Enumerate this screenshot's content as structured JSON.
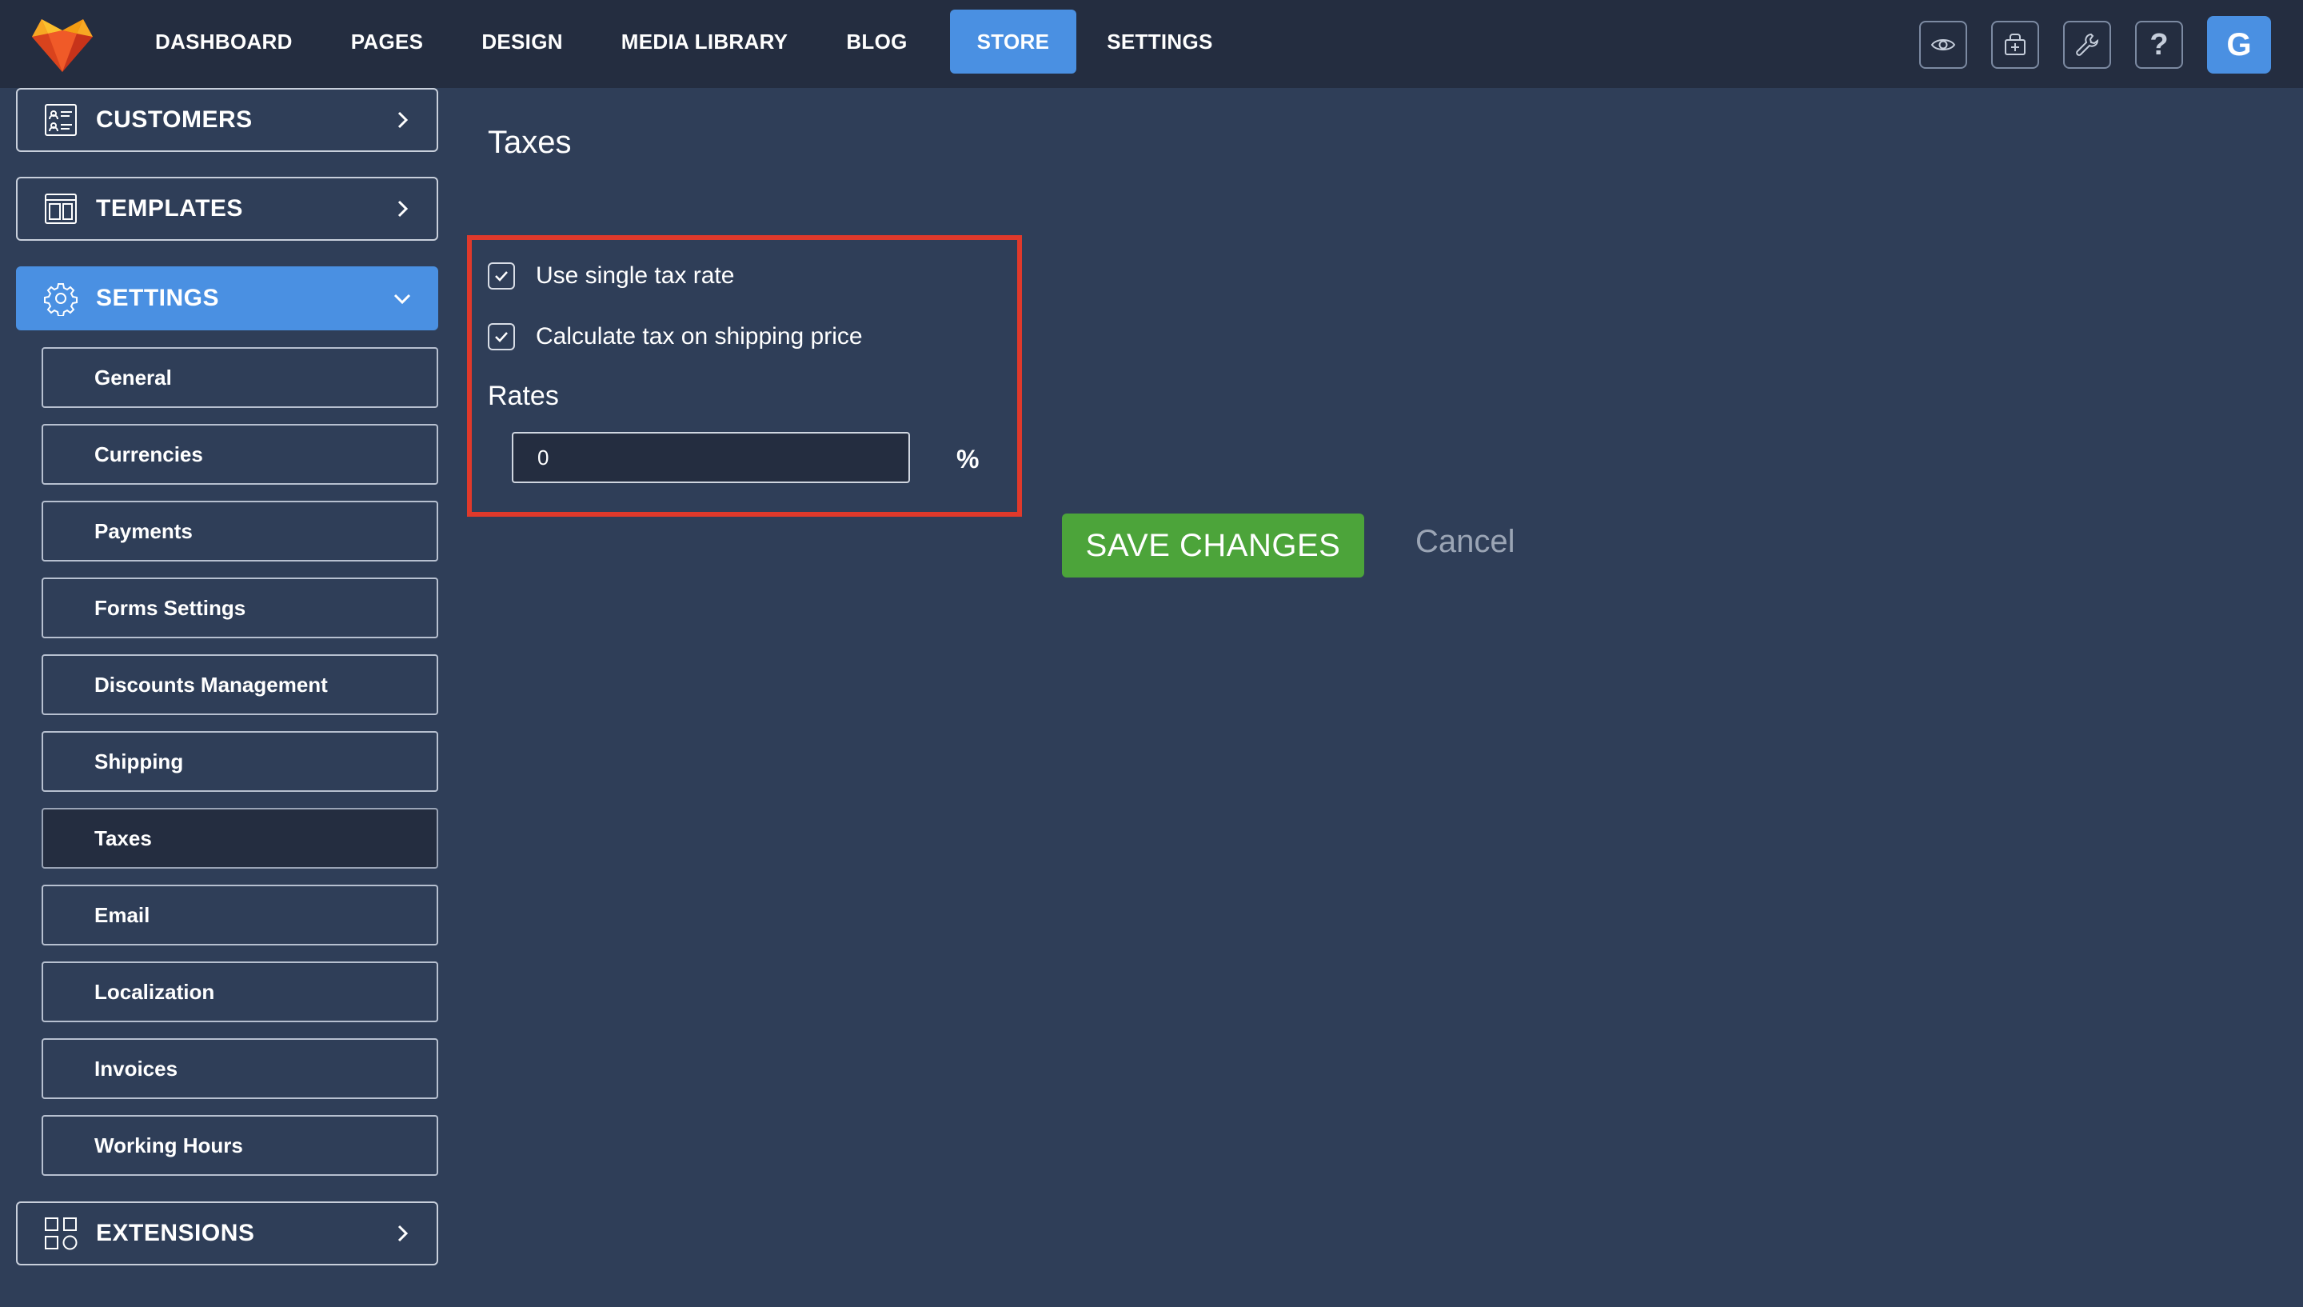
{
  "topbar": {
    "nav": [
      "DASHBOARD",
      "PAGES",
      "DESIGN",
      "MEDIA LIBRARY",
      "BLOG",
      "STORE",
      "SETTINGS"
    ],
    "active_nav": "STORE",
    "icons": [
      "eye-icon",
      "store-add-icon",
      "wrench-icon",
      "help-icon"
    ],
    "help_glyph": "?",
    "avatar_letter": "G"
  },
  "sidebar": {
    "customers": "CUSTOMERS",
    "templates": "TEMPLATES",
    "settings": "SETTINGS",
    "extensions": "EXTENSIONS",
    "settings_items": [
      "General",
      "Currencies",
      "Payments",
      "Forms Settings",
      "Discounts Management",
      "Shipping",
      "Taxes",
      "Email",
      "Localization",
      "Invoices",
      "Working Hours"
    ],
    "active_item": "Taxes"
  },
  "main": {
    "title": "Taxes",
    "single_rate_label": "Use single tax rate",
    "single_rate_checked": true,
    "shipping_tax_label": "Calculate tax on shipping price",
    "shipping_tax_checked": true,
    "rates_label": "Rates",
    "rate_value": "0",
    "percent_symbol": "%",
    "save_label": "SAVE CHANGES",
    "cancel_label": "Cancel"
  },
  "colors": {
    "accent": "#4a90e2",
    "save": "#4ca43a",
    "highlight": "#e0392b",
    "background": "#2f3e58",
    "topbar": "#242d40"
  }
}
